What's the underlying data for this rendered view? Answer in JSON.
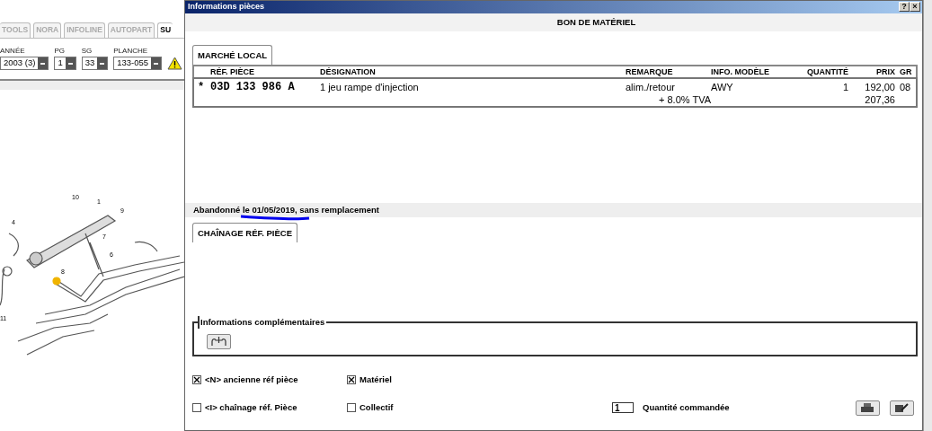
{
  "background": {
    "tabs": [
      {
        "label": "TOOLS",
        "selected": false
      },
      {
        "label": "NORA",
        "selected": false
      },
      {
        "label": "INFOLINE",
        "selected": false
      },
      {
        "label": "AUTOPART",
        "selected": false
      },
      {
        "label": "SU",
        "selected": true
      }
    ],
    "selectors": [
      {
        "label": "ANNÉE",
        "value": "2003 (3)"
      },
      {
        "label": "PG",
        "value": "1"
      },
      {
        "label": "SG",
        "value": "33"
      },
      {
        "label": "PLANCHE",
        "value": "133-055"
      }
    ],
    "callouts": [
      "10",
      "1",
      "9",
      "4",
      "7",
      "6",
      "8",
      "11"
    ]
  },
  "dialog": {
    "title": "Informations pièces",
    "title_buttons": [
      "?",
      "×"
    ],
    "header": "BON DE MATÉRIEL",
    "tabs": [
      {
        "label": "MARCHÉ LOCAL",
        "selected": true
      }
    ],
    "table": {
      "columns": [
        "RÉF. PIÈCE",
        "DÉSIGNATION",
        "REMARQUE",
        "INFO. MODÈLE",
        "QUANTITÉ",
        "PRIX",
        "GR"
      ],
      "rows": [
        {
          "marker": "*",
          "ref": "03D 133 986 A",
          "designation": "1 jeu rampe d'injection",
          "remarque": "alim./retour",
          "info": "AWY",
          "quantite": "1",
          "prix": "192,00",
          "gr": "08"
        }
      ],
      "tax": {
        "label": "+ 8.0% TVA",
        "amount": "207,36"
      }
    },
    "status": "Abandonné le 01/05/2019, sans remplacement",
    "lower_tabs": [
      {
        "label": "CHAÎNAGE RÉF. PIÈCE",
        "selected": true
      }
    ],
    "extra_info": {
      "legend": "Informations complémentaires"
    },
    "options": [
      {
        "label": "<N> ancienne réf pièce",
        "checked": true
      },
      {
        "label": "Matériel",
        "checked": true
      },
      {
        "label": "<I> chaînage réf. Pièce",
        "checked": false
      },
      {
        "label": "Collectif",
        "checked": false
      }
    ],
    "quantity": {
      "value": "1",
      "label": "Quantité commandée"
    }
  }
}
